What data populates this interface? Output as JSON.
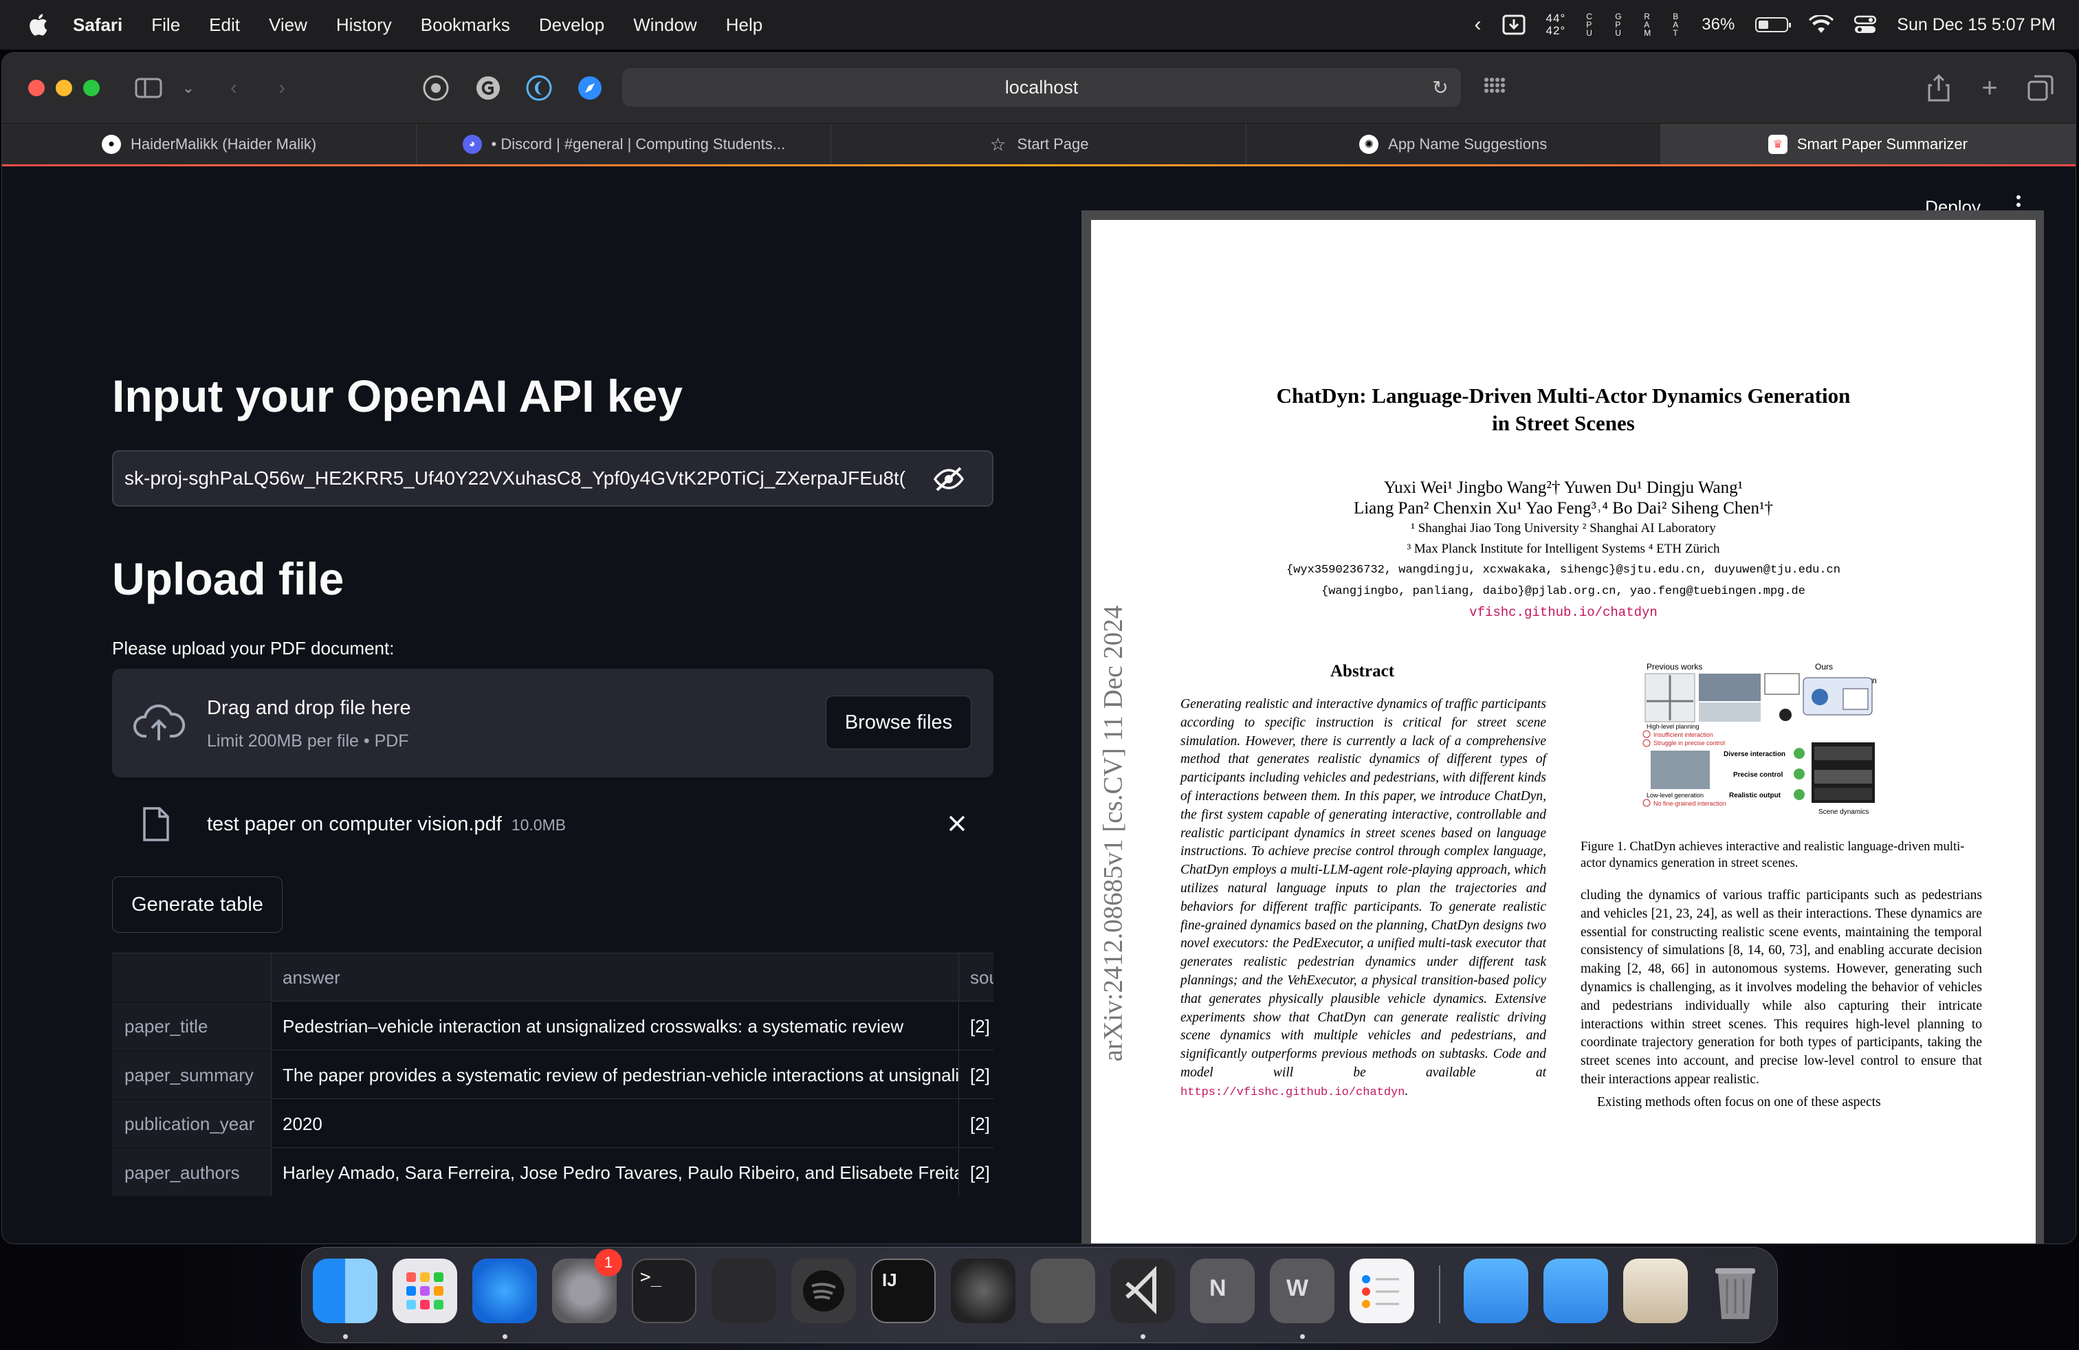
{
  "menubar": {
    "app": "Safari",
    "items": [
      "File",
      "Edit",
      "View",
      "History",
      "Bookmarks",
      "Develop",
      "Window",
      "Help"
    ],
    "temp_top": "44°",
    "temp_bottom": "42°",
    "stat_cpu": "C P U",
    "stat_gpu": "G P U",
    "stat_ram": "R A M",
    "stat_bat": "B A T",
    "battery_percent": "36%",
    "datetime": "Sun Dec 15  5:07 PM"
  },
  "browser": {
    "url": "localhost",
    "tabs": [
      {
        "label": "HaiderMalikk (Haider Malik)",
        "icon": "github-icon"
      },
      {
        "label": "• Discord | #general | Computing Students...",
        "icon": "discord-icon"
      },
      {
        "label": "Start Page",
        "icon": "star-icon"
      },
      {
        "label": "App Name Suggestions",
        "icon": "openai-icon"
      },
      {
        "label": "Smart Paper Summarizer",
        "icon": "streamlit-icon"
      }
    ],
    "active_tab": 4
  },
  "app": {
    "deploy_label": "Deploy",
    "api_heading": "Input your OpenAI API key",
    "api_key_value": "sk-proj-sghPaLQ56w_HE2KRR5_Uf40Y22VXuhasC8_Ypf0y4GVtK2P0TiCj_ZXerpaJFEu8t(",
    "upload_heading": "Upload file",
    "upload_label": "Please upload your PDF document:",
    "dropzone_title": "Drag and drop file here",
    "dropzone_subtitle": "Limit 200MB per file • PDF",
    "browse_label": "Browse files",
    "file_name": "test paper on computer vision.pdf",
    "file_size": "10.0MB",
    "generate_label": "Generate table",
    "table": {
      "headers": [
        "",
        "answer",
        "sou"
      ],
      "rows": [
        [
          "paper_title",
          "Pedestrian–vehicle interaction at unsignalized crosswalks: a systematic review",
          "[2]"
        ],
        [
          "paper_summary",
          "The paper provides a systematic review of pedestrian-vehicle interactions at unsignalized crosswalks",
          "[2]"
        ],
        [
          "publication_year",
          "2020",
          "[2]"
        ],
        [
          "paper_authors",
          "Harley Amado, Sara Ferreira, Jose Pedro Tavares, Paulo Ribeiro, and Elisabete Freitas",
          "[2]"
        ]
      ]
    }
  },
  "pdf": {
    "title_line1": "ChatDyn: Language-Driven Multi-Actor Dynamics Generation",
    "title_line2": "in Street Scenes",
    "authors_line1": "Yuxi Wei¹   Jingbo Wang²†   Yuwen Du¹   Dingju Wang¹",
    "authors_line2": "Liang Pan²   Chenxin Xu¹   Yao Feng³˒⁴   Bo Dai²   Siheng Chen¹†",
    "aff_line1": "¹ Shanghai Jiao Tong University    ² Shanghai AI Laboratory",
    "aff_line2": "³ Max Planck Institute for Intelligent Systems    ⁴ ETH Zürich",
    "email_line1": "{wyx3590236732, wangdingju, xcxwakaka, sihengc}@sjtu.edu.cn,   duyuwen@tju.edu.cn",
    "email_line2": "{wangjingbo, panliang, daibo}@pjlab.org.cn,   yao.feng@tuebingen.mpg.de",
    "project_link": "vfishc.github.io/chatdyn",
    "arxiv_stamp": "arXiv:2412.08685v1  [cs.CV]  11 Dec 2024",
    "abstract_heading": "Abstract",
    "abstract": "Generating realistic and interactive dynamics of traffic participants according to specific instruction is critical for street scene simulation. However, there is currently a lack of a comprehensive method that generates realistic dynamics of different types of participants including vehicles and pedestrians, with different kinds of interactions between them. In this paper, we introduce ChatDyn, the first system capable of generating interactive, controllable and realistic participant dynamics in street scenes based on language instructions. To achieve precise control through complex language, ChatDyn employs a multi-LLM-agent role-playing approach, which utilizes natural language inputs to plan the trajectories and behaviors for different traffic participants. To generate realistic fine-grained dynamics based on the planning, ChatDyn designs two novel executors: the PedExecutor, a unified multi-task executor that generates realistic pedestrian dynamics under different task plannings; and the VehExecutor, a physical transition-based policy that generates physically plausible vehicle dynamics. Extensive experiments show that ChatDyn can generate realistic driving scene dynamics with multiple vehicles and pedestrians, and significantly outperforms previous methods on subtasks. Code and model will be available at ",
    "abstract_link": "https://vfishc.github.io/chatdyn",
    "figure_labels": {
      "previous": "Previous works",
      "ours": "Ours",
      "chatdyn": "ChatDyn",
      "high_level": "High-level planning",
      "insufficient": "Insufficient interaction",
      "struggle": "Struggle in precise control",
      "low_level": "Low-level generation",
      "no_fine": "No fine-grained interaction",
      "diverse": "Diverse interaction",
      "precise": "Precise control",
      "realistic": "Realistic output",
      "scene_dynamics": "Scene dynamics"
    },
    "figure_caption": "Figure 1.  ChatDyn achieves interactive and realistic language-driven multi-actor dynamics generation in street scenes.",
    "col2_text": "cluding the dynamics of various traffic participants such as pedestrians and vehicles [21, 23, 24], as well as their interactions. These dynamics are essential for constructing realistic scene events, maintaining the temporal consistency of simulations [8, 14, 60, 73], and enabling accurate decision making [2, 48, 66] in autonomous systems. However, generating such dynamics is challenging, as it involves modeling the behavior of vehicles and pedestrians individually while also capturing their intricate interactions within street scenes. This requires high-level planning to coordinate trajectory generation for both types of participants, taking the street scenes into account, and precise low-level control to ensure that their interactions appear realistic.",
    "col2_para2": "Existing methods often focus on one of these aspects"
  },
  "dock": {
    "apps": [
      "finder-icon",
      "launchpad-icon",
      "safari-icon",
      "system-settings-icon",
      "terminal-icon",
      "zed-icon",
      "spotify-icon",
      "intellij-icon",
      "app-icon",
      "xcode-icon",
      "vscode-icon",
      "onenote-icon",
      "word-icon",
      "reminders-icon",
      "folder-icon",
      "folder-icon",
      "photo-icon",
      "trash-icon"
    ],
    "settings_badge": "1"
  },
  "colors": {
    "streamlit_bg": "#0e1117",
    "streamlit_widget": "#262730",
    "accent_red": "#ff4b4b",
    "link_magenta": "#c2185b",
    "ref_blue": "#1a3fbf"
  }
}
